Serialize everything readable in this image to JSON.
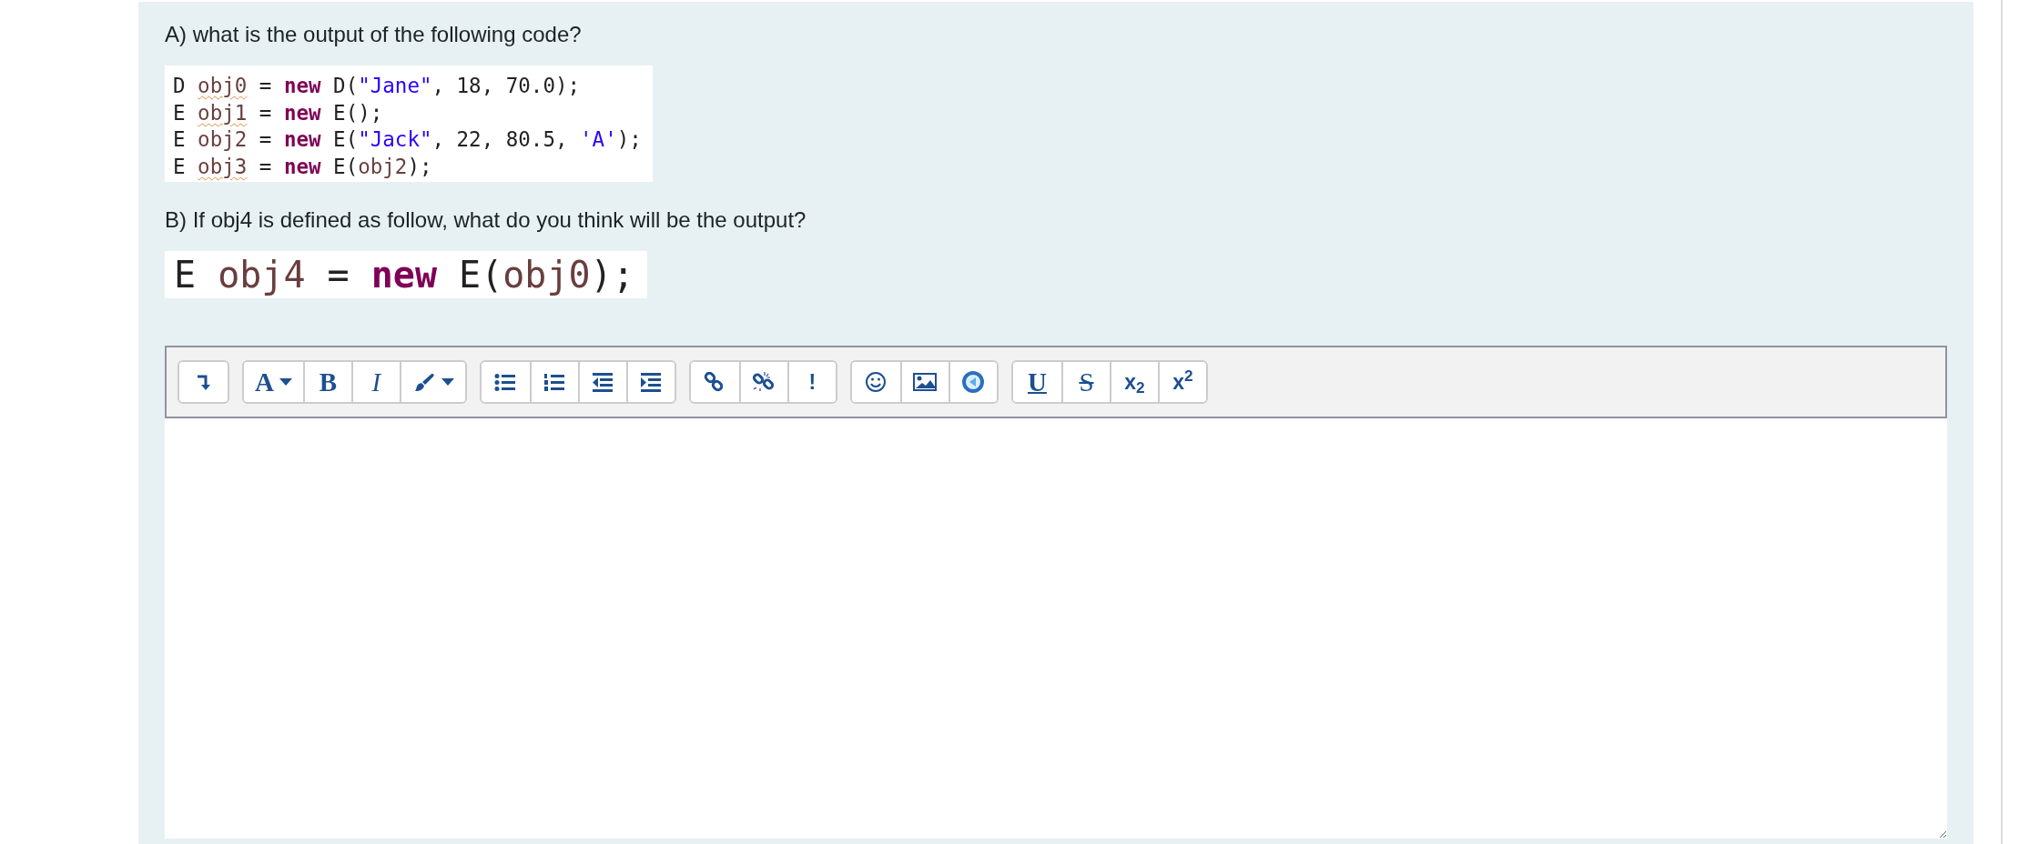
{
  "question_a": "A) what is the output of the following code?",
  "code_block": {
    "lines": [
      [
        {
          "text": "D ",
          "kind": "plain"
        },
        {
          "text": "obj0",
          "kind": "variable",
          "misspelled": true
        },
        {
          "text": " = ",
          "kind": "plain"
        },
        {
          "text": "new",
          "kind": "keyword"
        },
        {
          "text": " D(",
          "kind": "plain"
        },
        {
          "text": "\"Jane\"",
          "kind": "string"
        },
        {
          "text": ", 18, 70.0);",
          "kind": "plain"
        }
      ],
      [
        {
          "text": "E ",
          "kind": "plain"
        },
        {
          "text": "obj1",
          "kind": "variable",
          "misspelled": true
        },
        {
          "text": " = ",
          "kind": "plain"
        },
        {
          "text": "new",
          "kind": "keyword"
        },
        {
          "text": " E();",
          "kind": "plain"
        }
      ],
      [
        {
          "text": "E ",
          "kind": "plain"
        },
        {
          "text": "obj2",
          "kind": "variable",
          "misspelled": false
        },
        {
          "text": " = ",
          "kind": "plain"
        },
        {
          "text": "new",
          "kind": "keyword"
        },
        {
          "text": " E(",
          "kind": "plain"
        },
        {
          "text": "\"Jack\"",
          "kind": "string"
        },
        {
          "text": ", 22, 80.5, ",
          "kind": "plain"
        },
        {
          "text": "'A'",
          "kind": "string"
        },
        {
          "text": ");",
          "kind": "plain"
        }
      ],
      [
        {
          "text": "E ",
          "kind": "plain"
        },
        {
          "text": "obj3",
          "kind": "variable",
          "misspelled": true
        },
        {
          "text": " = ",
          "kind": "plain"
        },
        {
          "text": "new",
          "kind": "keyword"
        },
        {
          "text": " E(",
          "kind": "plain"
        },
        {
          "text": "obj2",
          "kind": "variable",
          "misspelled": false
        },
        {
          "text": ");",
          "kind": "plain"
        }
      ]
    ]
  },
  "question_b": "B) If obj4 is defined as follow, what do you think will be the output?",
  "code_large": {
    "lines": [
      [
        {
          "text": "E ",
          "kind": "plain"
        },
        {
          "text": "obj4",
          "kind": "variable",
          "misspelled": false
        },
        {
          "text": " = ",
          "kind": "plain"
        },
        {
          "text": "new",
          "kind": "keyword"
        },
        {
          "text": " E(",
          "kind": "plain"
        },
        {
          "text": "obj0",
          "kind": "variable",
          "misspelled": false
        },
        {
          "text": ");",
          "kind": "plain"
        }
      ]
    ]
  },
  "toolbar": {
    "groups": [
      {
        "buttons": [
          {
            "kind": "icon"
          }
        ]
      },
      {
        "buttons": [
          {
            "kind": "glyph",
            "label": "A",
            "bold": true,
            "italic": false,
            "underline": false,
            "strike": false,
            "serif": true,
            "dropdown": true
          },
          {
            "kind": "glyph",
            "label": "B",
            "bold": true,
            "italic": false,
            "underline": false,
            "strike": false,
            "serif": true,
            "dropdown": false
          },
          {
            "kind": "glyph",
            "label": "I",
            "bold": false,
            "italic": true,
            "underline": false,
            "strike": false,
            "serif": true,
            "dropdown": false
          },
          {
            "kind": "icon",
            "dropdown": true
          }
        ]
      },
      {
        "buttons": [
          {
            "kind": "icon"
          },
          {
            "kind": "icon"
          },
          {
            "kind": "icon"
          },
          {
            "kind": "icon"
          }
        ]
      },
      {
        "buttons": [
          {
            "kind": "icon"
          },
          {
            "kind": "icon"
          },
          {
            "kind": "glyph",
            "label": "!",
            "bold": true,
            "italic": false,
            "underline": false,
            "strike": false,
            "serif": false,
            "dropdown": false
          }
        ]
      },
      {
        "buttons": [
          {
            "kind": "icon"
          },
          {
            "kind": "icon"
          },
          {
            "kind": "icon"
          }
        ]
      },
      {
        "buttons": [
          {
            "kind": "glyph",
            "label": "U",
            "bold": true,
            "italic": false,
            "underline": true,
            "strike": false,
            "serif": true,
            "dropdown": false
          },
          {
            "kind": "glyph",
            "label": "S",
            "bold": false,
            "italic": false,
            "underline": false,
            "strike": true,
            "serif": true,
            "dropdown": false
          },
          {
            "kind": "glyph",
            "label": "x$_{2}$",
            "bold": true,
            "italic": false,
            "underline": false,
            "strike": false,
            "serif": false,
            "dropdown": false
          },
          {
            "kind": "glyph",
            "label": "x$^{2}$",
            "bold": true,
            "italic": false,
            "underline": false,
            "strike": false,
            "serif": false,
            "dropdown": false
          }
        ]
      }
    ]
  }
}
